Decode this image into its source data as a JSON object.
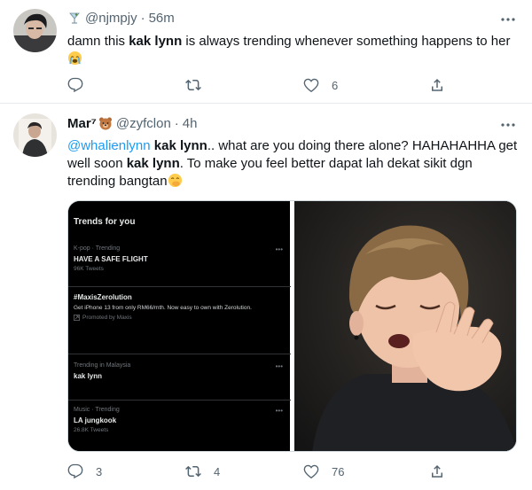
{
  "tweet1": {
    "handle": "@njmpjy",
    "dot": "·",
    "time": "56m",
    "text_before": "damn this ",
    "text_bold": "kak lynn",
    "text_after": " is always trending whenever something happens to her",
    "actions": {
      "reply_count": "",
      "retweet_count": "",
      "like_count": "6"
    }
  },
  "tweet2": {
    "name": "Mar⁷",
    "handle": "@zyfclon",
    "dot": "·",
    "time": "4h",
    "mention": "@whalienlynn",
    "bold1": " kak lynn",
    "text1": ".. what are you doing there alone? HAHAHAHHA get well soon ",
    "bold2": "kak lynn",
    "text2": ". To make you feel better dapat lah dekat sikit dgn trending bangtan",
    "media": {
      "screenshot_title": "Trends for you",
      "trends": [
        {
          "category": "K-pop · Trending",
          "name": "HAVE A SAFE FLIGHT",
          "sub": "96K Tweets"
        },
        {
          "category": "",
          "name": "#MaxisZerolution",
          "desc": "Get iPhone 13 from only RM66/mth. Now easy to own with Zerolution.",
          "sub": "Promoted by Maxis"
        },
        {
          "category": "Trending in Malaysia",
          "name": "kak lynn",
          "sub": ""
        },
        {
          "category": "Music · Trending",
          "name": "LA jungkook",
          "sub": "26.8K Tweets"
        }
      ]
    },
    "actions": {
      "reply_count": "3",
      "retweet_count": "4",
      "like_count": "76"
    }
  },
  "colors": {
    "accent": "#1d9bf0",
    "muted": "#536471",
    "divider": "#e6ecf0"
  },
  "icons": [
    "martini-glass-icon",
    "bear-face-icon",
    "more-dots-icon",
    "reply-icon",
    "retweet-icon",
    "like-icon",
    "share-icon",
    "crying-face-icon",
    "hand-over-mouth-face-icon",
    "promoted-icon"
  ]
}
